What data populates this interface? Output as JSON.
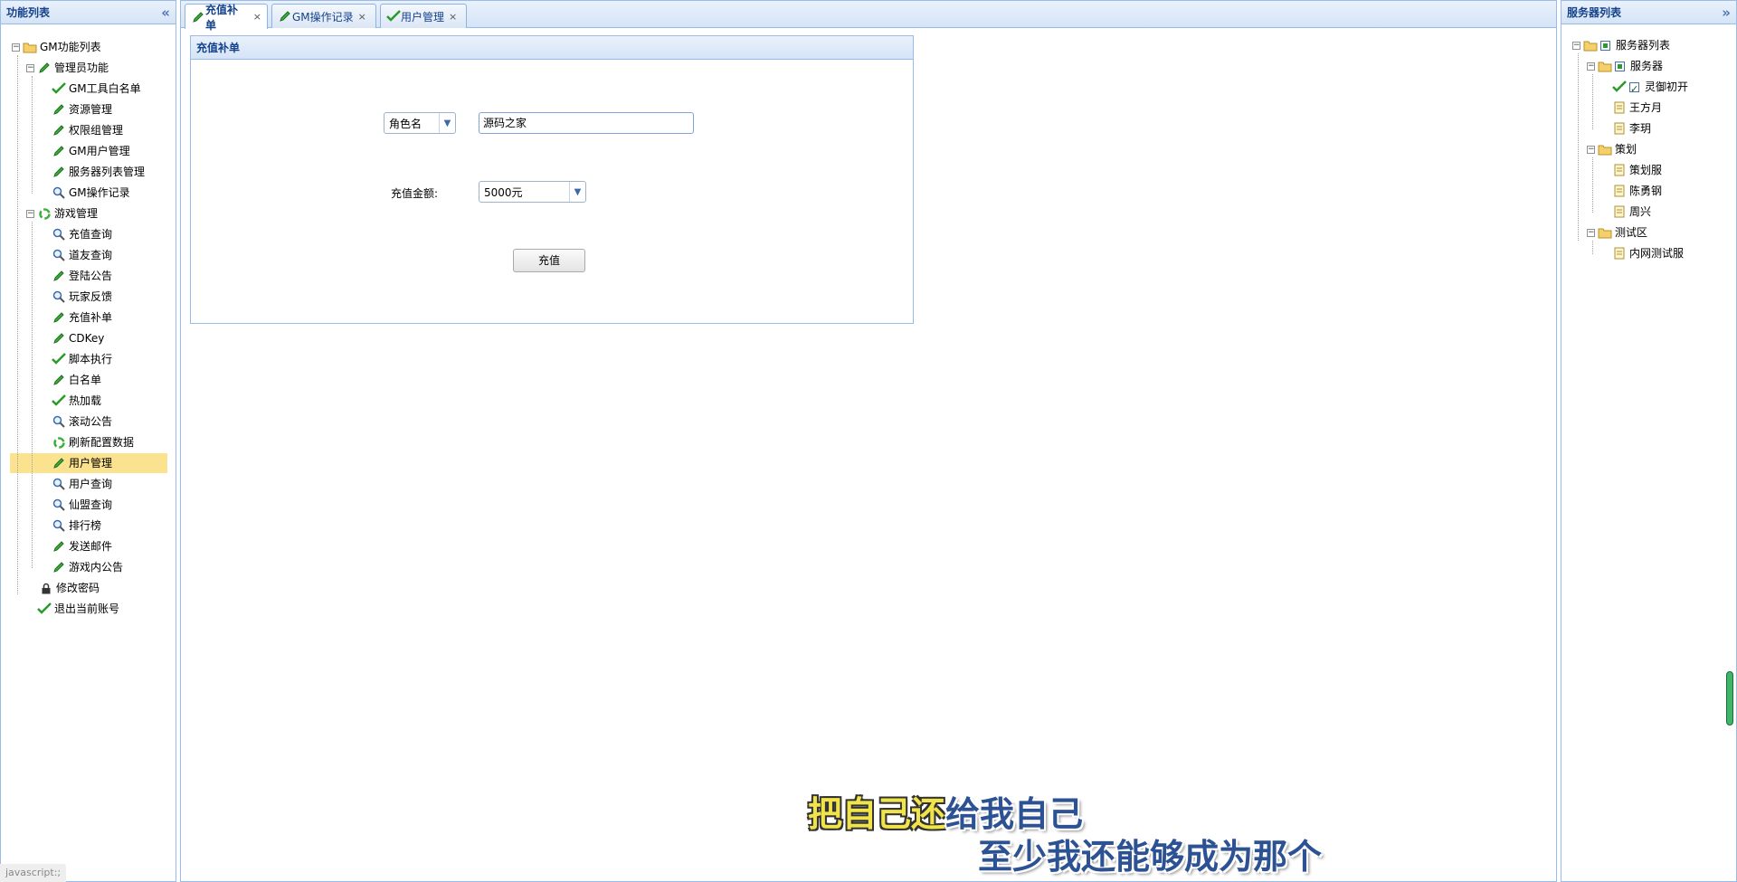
{
  "left_panel": {
    "title": "功能列表",
    "collapse_glyph": "«",
    "tree": {
      "root": "GM功能列表",
      "admin": {
        "label": "管理员功能",
        "items": [
          "GM工具白名单",
          "资源管理",
          "权限组管理",
          "GM用户管理",
          "服务器列表管理",
          "GM操作记录"
        ]
      },
      "game": {
        "label": "游戏管理",
        "items": [
          "充值查询",
          "道友查询",
          "登陆公告",
          "玩家反馈",
          "充值补单",
          "CDKey",
          "脚本执行",
          "白名单",
          "热加载",
          "滚动公告",
          "刷新配置数据",
          "用户管理",
          "用户查询",
          "仙盟查询",
          "排行榜",
          "发送邮件",
          "游戏内公告"
        ]
      },
      "change_password": "修改密码",
      "logout": "退出当前账号",
      "selected": "用户管理"
    }
  },
  "tabs": [
    {
      "label": "充值补单",
      "close": "×",
      "active": true
    },
    {
      "label": "GM操作记录",
      "close": "×",
      "active": false
    },
    {
      "label": "用户管理",
      "close": "×",
      "active": false
    }
  ],
  "form": {
    "title": "充值补单",
    "type_select": "角色名",
    "name_value": "源码之家",
    "amount_label": "充值金额:",
    "amount_select": "5000元",
    "submit": "充值"
  },
  "right_panel": {
    "title": "服务器列表",
    "collapse_glyph": "»",
    "tree": {
      "root": "服务器列表",
      "groups": [
        {
          "label": "服务器",
          "items": [
            "灵御初开",
            "王方月",
            "李玥"
          ]
        },
        {
          "label": "策划",
          "items": [
            "策划服",
            "陈勇钢",
            "周兴"
          ]
        },
        {
          "label": "测试区",
          "items": [
            "内网测试服"
          ]
        }
      ]
    }
  },
  "subtitles": {
    "line1_a": "把自己还",
    "line1_b": "给我自己",
    "line2": "至少我还能够成为那个"
  },
  "status_text": "javascript:;"
}
